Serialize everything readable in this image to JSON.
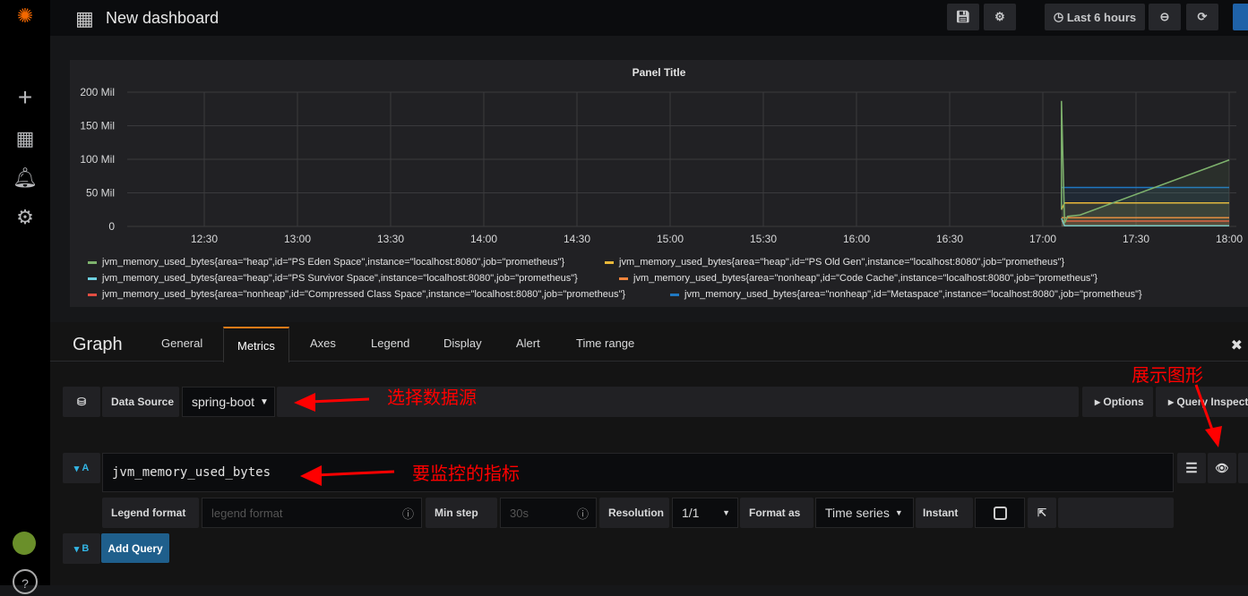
{
  "topbar": {
    "title": "New dashboard",
    "time_range": "Last 6 hours"
  },
  "panel": {
    "title": "Panel Title"
  },
  "chart_data": {
    "type": "line",
    "title": "Panel Title",
    "y_ticks": [
      "200 Mil",
      "150 Mil",
      "100 Mil",
      "50 Mil",
      "0"
    ],
    "ylim": [
      0,
      200000000
    ],
    "x_ticks": [
      "12:30",
      "13:00",
      "13:30",
      "14:00",
      "14:30",
      "15:00",
      "15:30",
      "16:00",
      "16:30",
      "17:00",
      "17:30",
      "18:00"
    ],
    "grid": true,
    "legend_placement": "bottom",
    "series": [
      {
        "name": "jvm_memory_used_bytes{area=\"heap\",id=\"PS Eden Space\",instance=\"localhost:8080\",job=\"prometheus\"}",
        "color": "#7eb26d",
        "points": [
          [
            "17:06",
            25000000
          ],
          [
            "17:06",
            187000000
          ],
          [
            "17:07",
            5000000
          ],
          [
            "17:08",
            15000000
          ],
          [
            "17:12",
            17000000
          ],
          [
            "18:00",
            99000000
          ]
        ]
      },
      {
        "name": "jvm_memory_used_bytes{area=\"heap\",id=\"PS Old Gen\",instance=\"localhost:8080\",job=\"prometheus\"}",
        "color": "#eab839",
        "points": [
          [
            "17:06",
            25000000
          ],
          [
            "17:07",
            35000000
          ],
          [
            "18:00",
            35000000
          ]
        ]
      },
      {
        "name": "jvm_memory_used_bytes{area=\"heap\",id=\"PS Survivor Space\",instance=\"localhost:8080\",job=\"prometheus\"}",
        "color": "#6ed0e0",
        "points": [
          [
            "17:06",
            12000000
          ],
          [
            "17:07",
            1000000
          ],
          [
            "18:00",
            1000000
          ]
        ]
      },
      {
        "name": "jvm_memory_used_bytes{area=\"nonheap\",id=\"Code Cache\",instance=\"localhost:8080\",job=\"prometheus\"}",
        "color": "#ef843c",
        "points": [
          [
            "17:06",
            13000000
          ],
          [
            "18:00",
            13000000
          ]
        ]
      },
      {
        "name": "jvm_memory_used_bytes{area=\"nonheap\",id=\"Compressed Class Space\",instance=\"localhost:8080\",job=\"prometheus\"}",
        "color": "#e24d42",
        "points": [
          [
            "17:06",
            8000000
          ],
          [
            "18:00",
            8000000
          ]
        ]
      },
      {
        "name": "jvm_memory_used_bytes{area=\"nonheap\",id=\"Metaspace\",instance=\"localhost:8080\",job=\"prometheus\"}",
        "color": "#1f78c1",
        "points": [
          [
            "17:06",
            58000000
          ],
          [
            "18:00",
            58000000
          ]
        ]
      }
    ]
  },
  "editor": {
    "title": "Graph",
    "tabs": [
      "General",
      "Metrics",
      "Axes",
      "Legend",
      "Display",
      "Alert",
      "Time range"
    ],
    "active_tab": "Metrics",
    "data_source_label": "Data Source",
    "data_source": "spring-boot",
    "options": "Options",
    "query_inspector": "Query Inspector",
    "query": {
      "ref": "A",
      "expr": "jvm_memory_used_bytes",
      "legend_format_label": "Legend format",
      "legend_format_placeholder": "legend format",
      "min_step_label": "Min step",
      "min_step_placeholder": "30s",
      "resolution_label": "Resolution",
      "resolution": "1/1",
      "format_as_label": "Format as",
      "format_as": "Time series",
      "instant_label": "Instant",
      "instant": false
    },
    "next_ref": "B",
    "add_query": "Add Query"
  },
  "annotations": {
    "datasource": "选择数据源",
    "metric": "要监控的指标",
    "show": "展示图形"
  }
}
